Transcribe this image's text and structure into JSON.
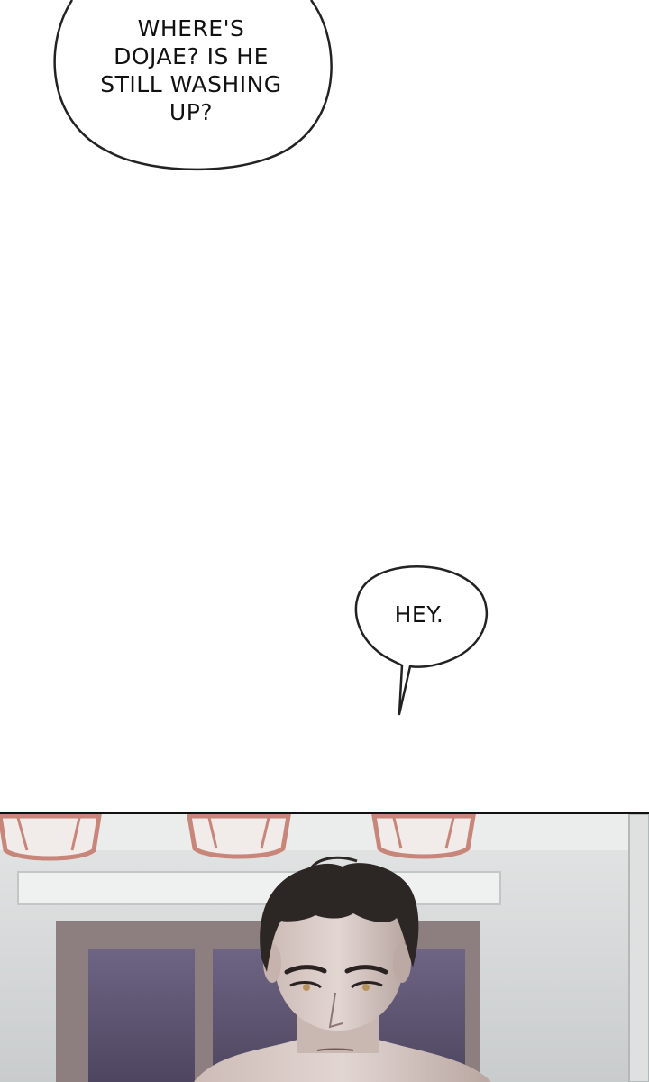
{
  "bubbles": [
    {
      "lines": [
        "WHERE'S",
        "DOJAE? IS HE",
        "STILL WASHING",
        "UP?"
      ]
    },
    {
      "lines": [
        "HEY."
      ]
    }
  ],
  "colors": {
    "background": "#ffffff",
    "bubble_stroke": "#222222",
    "panel_border": "#111111",
    "lamp": "#c8857a",
    "wall": "#d9dcdc",
    "window": "#5e5470",
    "hair": "#2c2624",
    "skin": "#d8cbc6"
  }
}
